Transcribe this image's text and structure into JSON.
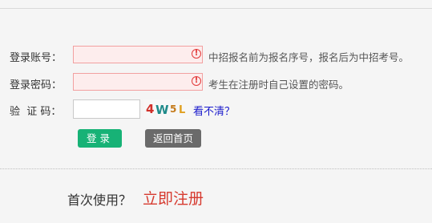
{
  "form": {
    "account": {
      "label": "登录账号：",
      "value": "",
      "hint": "中招报名前为报名序号，报名后为中招考号。"
    },
    "password": {
      "label": "登录密码：",
      "value": "",
      "hint": "考生在注册时自己设置的密码。"
    },
    "captcha": {
      "label": "验  证 码：",
      "value": "",
      "image_text": "4W5L",
      "refresh_label": "看不清？"
    },
    "warning_icon": "exclamation-circle-icon",
    "warning_symbol": "!"
  },
  "buttons": {
    "login_label": "登录",
    "home_label": "返回首页"
  },
  "footer": {
    "first_use_text": "首次使用？",
    "register_label": "立即注册"
  },
  "colors": {
    "error_border": "#f2a0a0",
    "error_bg": "#fdeded",
    "error_icon": "#e23a3a",
    "login_button": "#17b276",
    "home_button": "#6a6a6a",
    "refresh_link": "#1a1acc",
    "register_link": "#d63a2f",
    "page_bg": "#f5f5f5"
  }
}
